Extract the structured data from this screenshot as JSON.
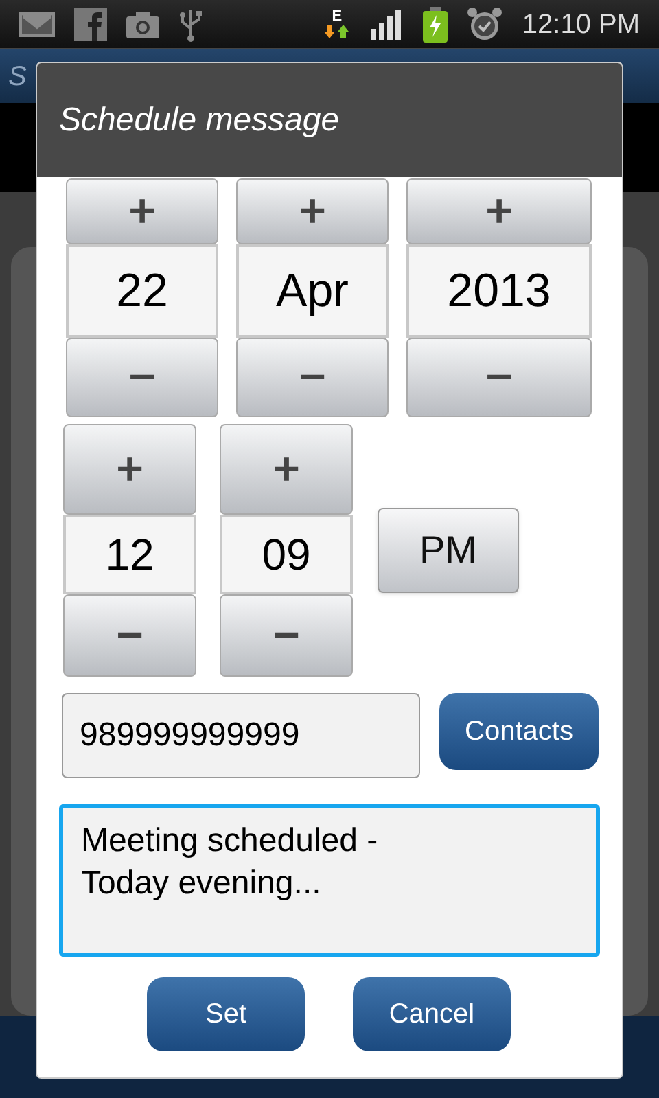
{
  "status_bar": {
    "network_type": "E",
    "time": "12:10 PM"
  },
  "background_app": {
    "title": "S"
  },
  "dialog": {
    "title": "Schedule message",
    "date_pickers": [
      {
        "increment": "+",
        "value": "22",
        "decrement": "−"
      },
      {
        "increment": "+",
        "value": "Apr",
        "decrement": "−"
      },
      {
        "increment": "+",
        "value": "2013",
        "decrement": "−"
      }
    ],
    "time_pickers": [
      {
        "increment": "+",
        "value": "12",
        "decrement": "−"
      },
      {
        "increment": "+",
        "value": "09",
        "decrement": "−"
      }
    ],
    "am_pm_button": "PM",
    "phone_field": {
      "value": "989999999999"
    },
    "contacts_button": "Contacts",
    "message_field": {
      "value": "Meeting scheduled -\nToday evening...",
      "focused": true
    },
    "buttons": [
      "Set",
      "Cancel"
    ]
  }
}
